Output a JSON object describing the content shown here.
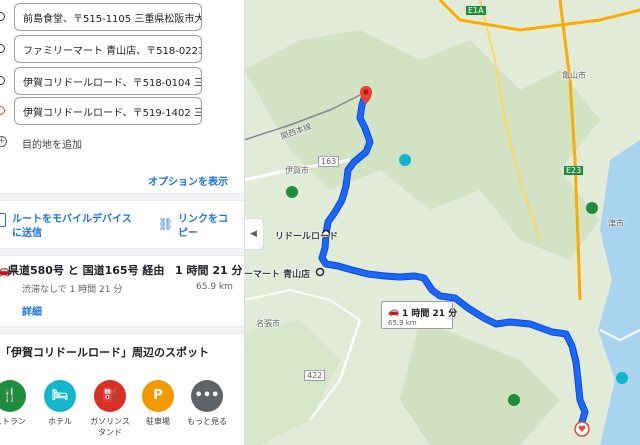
{
  "directions": {
    "stops": [
      {
        "value": "前島食堂、〒515-1105 三重県松阪市大河",
        "kind": "origin"
      },
      {
        "value": "ファミリーマート 青山店、〒518-0221 三",
        "kind": "waypoint"
      },
      {
        "value": "伊賀コリドールロード、〒518-0104 三重",
        "kind": "waypoint"
      },
      {
        "value": "伊賀コリドールロード、〒519-1402 三重県",
        "kind": "destination"
      }
    ],
    "add_destination": "目的地を追加",
    "options_link": "オプションを表示",
    "send_to_mobile": "ルートをモバイルデバイスに送信",
    "copy_link": "リンクをコピー"
  },
  "route": {
    "name": "県道580号 と 国道165号 経由",
    "time": "1 時間 21 分",
    "traffic_note": "渋滞なしで 1 時間 21 分",
    "distance": "65.9 km",
    "details_link": "詳細"
  },
  "nearby": {
    "title": "「伊賀コリドールロード」周辺のスポット",
    "categories": [
      {
        "label": "ストラン",
        "icon": "restaurant-icon",
        "color": "#1e8e3e"
      },
      {
        "label": "ホテル",
        "icon": "hotel-icon",
        "color": "#12b5cb"
      },
      {
        "label": "ガソリンス\nタンド",
        "icon": "gas-station-icon",
        "color": "#d93025"
      },
      {
        "label": "駐車場",
        "icon": "parking-icon",
        "color": "#f29900"
      },
      {
        "label": "もっと見る",
        "icon": "more-icon",
        "color": "#5f6368"
      }
    ]
  },
  "map": {
    "place_labels": {
      "waypoint_corridor": "リドールロード",
      "waypoint_familymart": "ーマート 青山店",
      "iga_city": "伊賀市",
      "kameyama_city": "亀山市",
      "tsu_city": "津市",
      "nabari_city": "名張市",
      "kansai_line": "関西本線"
    },
    "road_shields": {
      "r163": "163",
      "r422": "422",
      "e23": "E23",
      "e1a": "E1A"
    },
    "route_badge": {
      "time": "1 時間 21 分",
      "distance": "65.9 km"
    },
    "colors": {
      "route": "#1a66ff",
      "destination_marker": "#ea4335",
      "link": "#1a73e8"
    }
  }
}
